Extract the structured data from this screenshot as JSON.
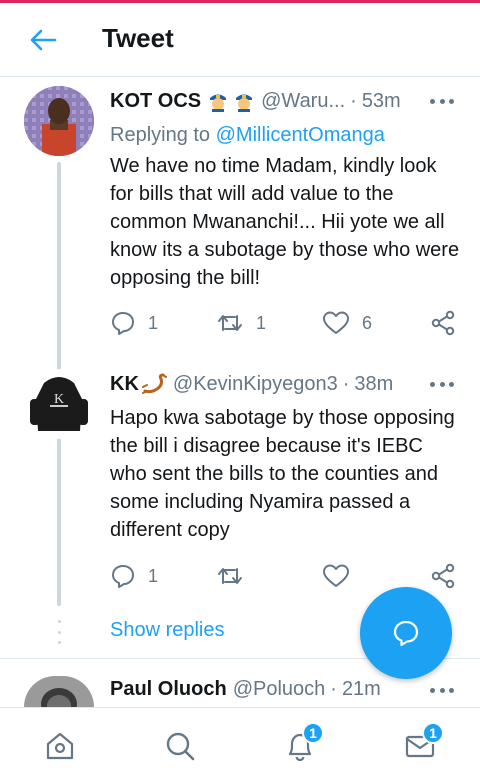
{
  "header": {
    "title": "Tweet",
    "back_icon": "arrow-left-icon"
  },
  "colors": {
    "accent": "#1da1f2",
    "text": "#14171a",
    "muted": "#657786",
    "divider": "#e1e8ed",
    "top_strip": "#e0245e"
  },
  "tweets": [
    {
      "name": "KOT OCS",
      "emoji": [
        "police-officer-emoji",
        "police-officer-emoji"
      ],
      "handle": "@Waru...",
      "time": "53m",
      "reply_prefix": "Replying to",
      "reply_to": "@MillicentOmanga",
      "text": "We have no time Madam, kindly look for bills that will add value to the common Mwananchi!... Hii yote we all know its a subotage by those who were opposing the bill!",
      "reply_count": "1",
      "retweet_count": "1",
      "like_count": "6"
    },
    {
      "name": "KK",
      "emoji": [
        "scorpion-emoji"
      ],
      "handle": "@KevinKipyegon3",
      "time": "38m",
      "text": "Hapo kwa sabotage by those opposing the bill i disagree because it's IEBC who sent the bills to the counties and some including Nyamira passed a different copy",
      "reply_count": "1",
      "retweet_count": "",
      "like_count": ""
    },
    {
      "name": "Paul Oluoch",
      "handle": "@Poluoch",
      "time": "21m"
    }
  ],
  "thread": {
    "show_replies": "Show replies"
  },
  "separator": "·",
  "nav": {
    "home_icon": "home-icon",
    "search_icon": "search-icon",
    "notifications_icon": "bell-icon",
    "notifications_badge": "1",
    "messages_icon": "mail-icon",
    "messages_badge": "1"
  },
  "fab": {
    "icon": "compose-reply-icon"
  }
}
